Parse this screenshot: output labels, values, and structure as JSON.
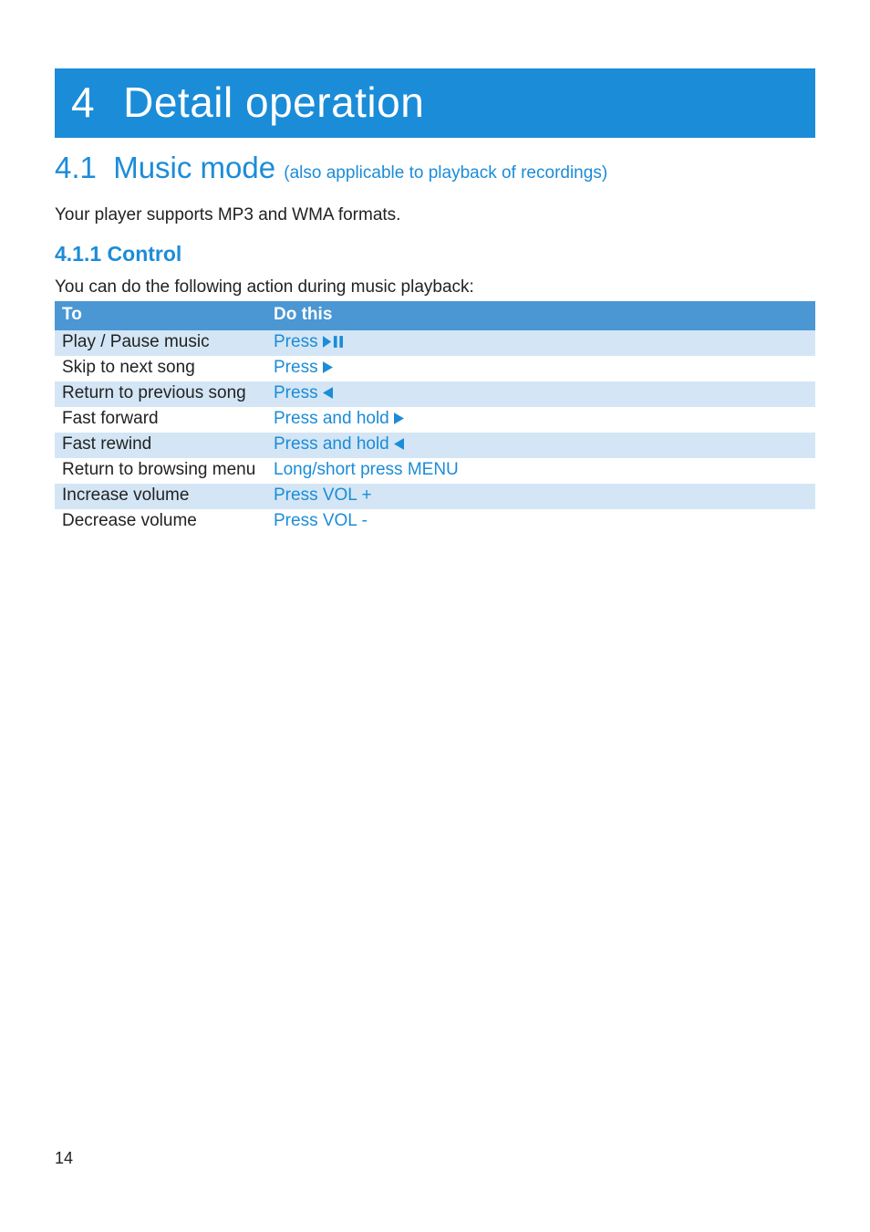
{
  "chapter": {
    "number": "4",
    "title": "Detail operation"
  },
  "section": {
    "number": "4.1",
    "title": "Music mode",
    "subtitle": "(also applicable to playback of recordings)"
  },
  "intro": "Your player supports MP3 and WMA formats.",
  "subsection": {
    "number": "4.1.1",
    "title": "Control"
  },
  "table_intro": "You can do the following action during music playback:",
  "table": {
    "headers": {
      "to": "To",
      "do": "Do this"
    },
    "rows": [
      {
        "to": "Play / Pause music",
        "do_prefix": "Press ",
        "icon": "play-pause",
        "do_suffix": "",
        "shade": true
      },
      {
        "to": "Skip to next song",
        "do_prefix": "Press ",
        "icon": "right",
        "do_suffix": "",
        "shade": false
      },
      {
        "to": "Return to previous song",
        "do_prefix": "Press ",
        "icon": "left",
        "do_suffix": "",
        "shade": true
      },
      {
        "to": "Fast forward",
        "do_prefix": "Press and hold ",
        "icon": "right",
        "do_suffix": "",
        "shade": false
      },
      {
        "to": "Fast rewind",
        "do_prefix": "Press and hold ",
        "icon": "left",
        "do_suffix": "",
        "shade": true
      },
      {
        "to": "Return to browsing menu",
        "do_prefix": "Long/short press ",
        "icon": "",
        "do_suffix": "MENU",
        "shade": false
      },
      {
        "to": "Increase volume",
        "do_prefix": "Press ",
        "icon": "",
        "do_suffix": "VOL +",
        "shade": true
      },
      {
        "to": "Decrease volume",
        "do_prefix": "Press ",
        "icon": "",
        "do_suffix": "VOL -",
        "shade": false
      }
    ]
  },
  "page_number": "14",
  "colors": {
    "brand_blue": "#1b8cd8",
    "header_blue": "#4a97d3",
    "row_shade": "#d4e6f5"
  }
}
